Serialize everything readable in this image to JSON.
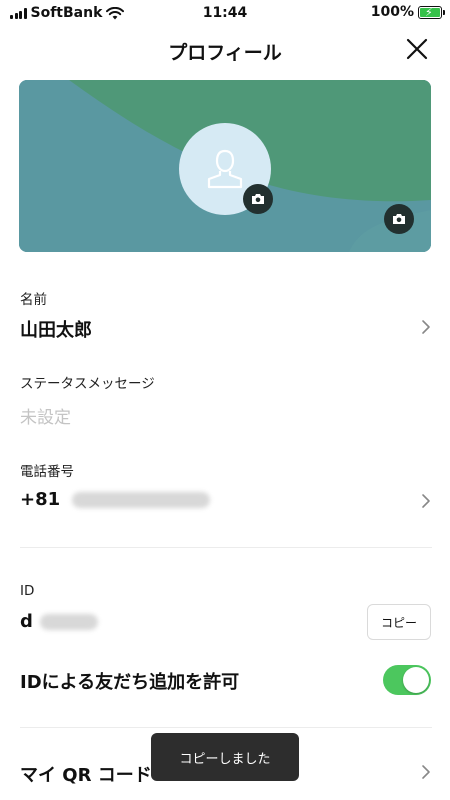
{
  "status_bar": {
    "carrier": "SoftBank",
    "time": "11:44",
    "battery": "100%",
    "battery_level": 100
  },
  "header": {
    "title": "プロフィール"
  },
  "cover": {
    "colors": {
      "teal": "#5a98a1",
      "green": "#4f9878"
    }
  },
  "fields": {
    "name": {
      "label": "名前",
      "value": "山田太郎"
    },
    "status_message": {
      "label": "ステータスメッセージ",
      "placeholder": "未設定"
    },
    "phone": {
      "label": "電話番号",
      "prefix": "+81"
    },
    "id": {
      "label": "ID",
      "prefix": "d",
      "copy_button": "コピー"
    },
    "allow_id_search": {
      "label": "IDによる友だち追加を許可",
      "enabled": true
    },
    "qr_code": {
      "label": "マイ QR コード"
    }
  },
  "toast": {
    "message": "コピーしました"
  },
  "colors": {
    "toggle_on": "#4cc75e",
    "toast_bg": "#2d2d2d"
  }
}
